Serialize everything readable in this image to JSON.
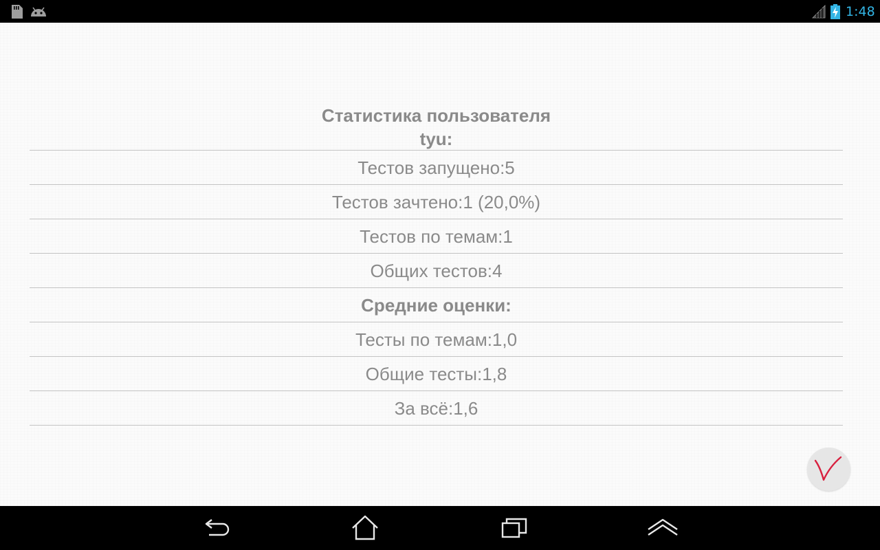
{
  "status_bar": {
    "left_icons": [
      "sd-card-icon",
      "android-icon"
    ],
    "right_icons": [
      "signal-icon",
      "battery-charging-icon"
    ],
    "time": "1:48",
    "accent_color": "#33b5e5"
  },
  "stats": {
    "title_line1": "Статистика пользователя",
    "title_line2": "tyu:",
    "rows": [
      "Тестов запущено:5",
      "Тестов зачтено:1 (20,0%)",
      "Тестов по темам:1",
      "Общих тестов:4",
      "Средние оценки:",
      "Тесты по темам:1,0",
      "Общие тесты:1,8",
      "За всё:1,6"
    ],
    "text_color": "#8a8a8a"
  },
  "fab": {
    "icon": "checkmark-icon",
    "color": "#d8203f"
  },
  "nav_bar": {
    "buttons": [
      "back-icon",
      "home-icon",
      "recent-apps-icon",
      "menu-up-icon"
    ]
  }
}
